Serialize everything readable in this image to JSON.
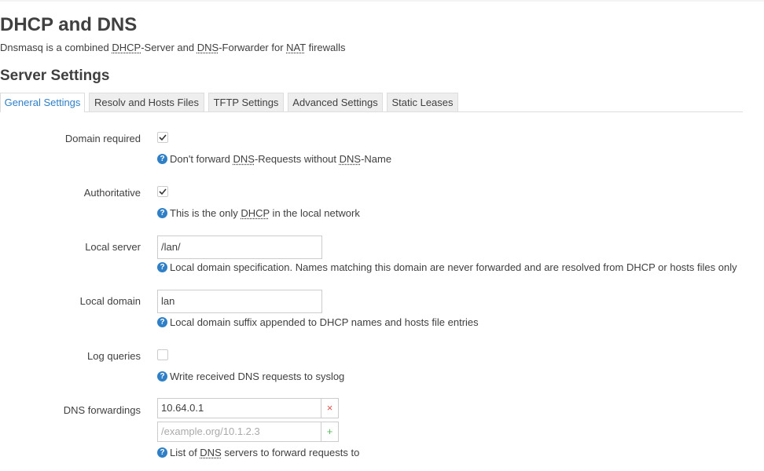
{
  "page": {
    "title": "DHCP and DNS",
    "description_parts": [
      "Dnsmasq is a combined ",
      "DHCP",
      "-Server and ",
      "DNS",
      "-Forwarder for ",
      "NAT",
      " firewalls"
    ]
  },
  "section": {
    "title": "Server Settings"
  },
  "tabs": [
    {
      "label": "General Settings",
      "active": true
    },
    {
      "label": "Resolv and Hosts Files",
      "active": false
    },
    {
      "label": "TFTP Settings",
      "active": false
    },
    {
      "label": "Advanced Settings",
      "active": false
    },
    {
      "label": "Static Leases",
      "active": false
    }
  ],
  "fields": {
    "domain_required": {
      "label": "Domain required",
      "checked": true,
      "help_parts": [
        "Don't forward ",
        "DNS",
        "-Requests without ",
        "DNS",
        "-Name"
      ]
    },
    "authoritative": {
      "label": "Authoritative",
      "checked": true,
      "help_parts": [
        "This is the only ",
        "DHCP",
        " in the local network"
      ]
    },
    "local_server": {
      "label": "Local server",
      "value": "/lan/",
      "help": "Local domain specification. Names matching this domain are never forwarded and are resolved from DHCP or hosts files only"
    },
    "local_domain": {
      "label": "Local domain",
      "value": "lan",
      "help": "Local domain suffix appended to DHCP names and hosts file entries"
    },
    "log_queries": {
      "label": "Log queries",
      "checked": false,
      "help": "Write received DNS requests to syslog"
    },
    "dns_forwardings": {
      "label": "DNS forwardings",
      "entries": [
        "10.64.0.1"
      ],
      "placeholder": "/example.org/10.1.2.3",
      "remove_symbol": "×",
      "add_symbol": "+",
      "help_parts": [
        "List of ",
        "DNS",
        " servers to forward requests to"
      ]
    }
  },
  "colors": {
    "accent": "#2f7fc7",
    "remove": "#d9534f",
    "add": "#5cb85c",
    "text": "#404040"
  },
  "icons": {
    "help": "question-circle-icon",
    "check": "checkmark-icon"
  },
  "help_icon_glyph": "?"
}
